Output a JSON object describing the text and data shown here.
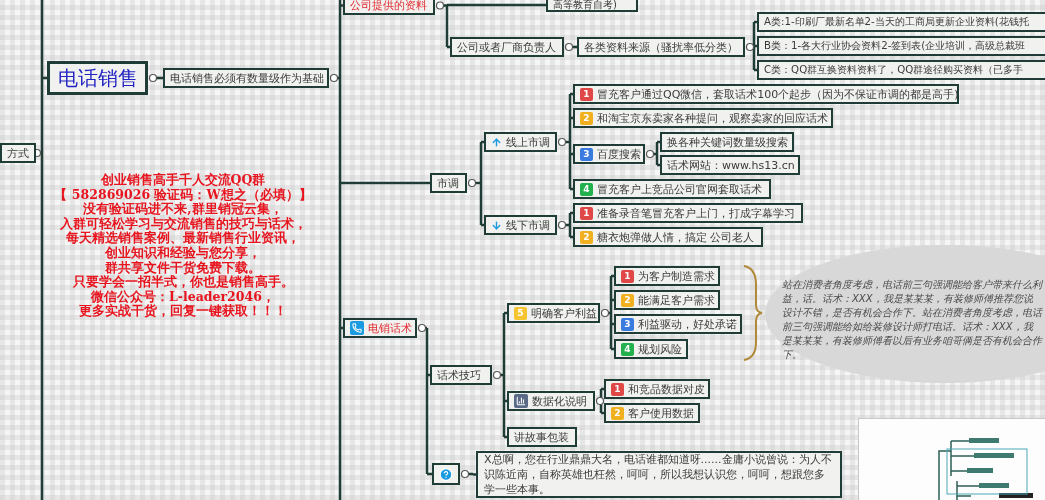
{
  "side_topic": {
    "text": "方式"
  },
  "promo_text": {
    "lines": [
      "创业销售高手千人交流QQ群",
      "【 582869026 验证码：W想之（必填）】",
      "没有验证码进不来,群里销冠云集，",
      "入群可轻松学习与交流销售的技巧与话术，",
      "每天精选销售案例、最新销售行业资讯，",
      "创业知识和经验与您分享，",
      "群共享文件干货免费下载。",
      "只要学会一招半式，你也是销售高手。",
      "微信公众号：L-leader2046，",
      "更多实战干货，回复一键获取！！！"
    ]
  },
  "mind_map": {
    "text": "电话销售",
    "kind": "root",
    "children": [
      {
        "text": "电话销售必须有数量级作为基础",
        "kind": "plain",
        "children": [
          {
            "text": "公司提供的资料",
            "kind": "heading",
            "children": [
              {
                "text": "高等教育自考)",
                "kind": "plain"
              },
              {
                "text": "公司或者厂商负责人",
                "kind": "plain",
                "children": [
                  {
                    "text": "各类资料来源（骚扰率低分类）",
                    "kind": "plain",
                    "children": [
                      {
                        "text": "A类:1-印刷厂最新名单2-当天的工商局更新企业资料(花钱托",
                        "kind": "plain"
                      },
                      {
                        "text": "B类：1-各大行业协会资料2-签到表(企业培训，高级总裁班",
                        "kind": "plain"
                      },
                      {
                        "text": "C类：QQ群互换资料资料了，QQ群途径购买资料（已多手",
                        "kind": "plain"
                      }
                    ]
                  }
                ]
              }
            ]
          },
          {
            "text": "市调",
            "kind": "plain",
            "children": [
              {
                "text": "线上市调",
                "kind": "plain",
                "children": [
                  {
                    "text": "冒充客户通过QQ微信，套取话术100个起步（因为不保证市调的都是高手)",
                    "kind": "plain",
                    "badge": {
                      "text": "1",
                      "color": "#e04848"
                    }
                  },
                  {
                    "text": "和淘宝京东卖家各种提问，观察卖家的回应话术",
                    "kind": "plain",
                    "badge": {
                      "text": "2",
                      "color": "#f0b020"
                    }
                  },
                  {
                    "text": "百度搜索",
                    "kind": "plain",
                    "badge": {
                      "text": "3",
                      "color": "#3a7be0"
                    },
                    "children": [
                      {
                        "text": "换各种关键词数量级搜索",
                        "kind": "plain"
                      },
                      {
                        "text": "话术网站：www.hs13.cn",
                        "kind": "plain"
                      }
                    ]
                  },
                  {
                    "text": "冒充客户上竞品公司官网套取话术",
                    "kind": "plain",
                    "badge": {
                      "text": "4",
                      "color": "#22b14c"
                    }
                  }
                ]
              },
              {
                "text": "线下市调",
                "kind": "plain",
                "children": [
                  {
                    "text": "准备录音笔冒充客户上门，打成字幕学习",
                    "kind": "plain",
                    "badge": {
                      "text": "1",
                      "color": "#e04848"
                    }
                  },
                  {
                    "text": "糖衣炮弹做人情，搞定 公司老人",
                    "kind": "plain",
                    "badge": {
                      "text": "2",
                      "color": "#f0b020"
                    }
                  }
                ]
              }
            ]
          },
          {
            "text": "电销话术",
            "kind": "heading",
            "children": [
              {
                "text": "话术技巧",
                "kind": "plain",
                "children": [
                  {
                    "text": "明确客户利益",
                    "kind": "plain",
                    "badge": {
                      "text": "5",
                      "color": "#f5c431"
                    },
                    "children": [
                      {
                        "text": "为客户制造需求",
                        "kind": "plain",
                        "badge": {
                          "text": "1",
                          "color": "#e04848"
                        }
                      },
                      {
                        "text": "能满足客户需求",
                        "kind": "plain",
                        "badge": {
                          "text": "2",
                          "color": "#f0b020"
                        }
                      },
                      {
                        "text": "利益驱动，好处承诺",
                        "kind": "plain",
                        "badge": {
                          "text": "3",
                          "color": "#3a7be0"
                        }
                      },
                      {
                        "text": "规划风险",
                        "kind": "plain",
                        "badge": {
                          "text": "4",
                          "color": "#22b14c"
                        }
                      }
                    ]
                  },
                  {
                    "text": "数据化说明",
                    "kind": "plain",
                    "children": [
                      {
                        "text": "和竞品数据对皮",
                        "kind": "plain",
                        "badge": {
                          "text": "1",
                          "color": "#e04848"
                        }
                      },
                      {
                        "text": "客户使用数据",
                        "kind": "plain",
                        "badge": {
                          "text": "2",
                          "color": "#f0b020"
                        }
                      }
                    ]
                  },
                  {
                    "text": "讲故事包装",
                    "kind": "plain"
                  }
                ]
              },
              {
                "kind": "plain",
                "children": [
                  {
                    "text": "X总啊，您在行业鼎鼎大名，电话谁都知道呀......金庸小说曾说：为人不识陈近南，自称英雄也枉然，呵呵，所以我想认识您，呵呵，想跟您多学一些本事。",
                    "kind": "paragraph"
                  }
                ]
              }
            ]
          }
        ]
      }
    ]
  },
  "callout": {
    "text": "站在消费者角度考虑，电话前三句强调能给客户带来什么利益，话。话术：XXX，我是某某某，有装修师傅推荐您说设计不错，是否有机会合作下。站在消费者角度考虑，电话前三句强调能给如给装修设计师打电话。话术：XXX，我是某某某，有装修师傅看以后有业务咱哥俩是否有机会合作下。"
  }
}
